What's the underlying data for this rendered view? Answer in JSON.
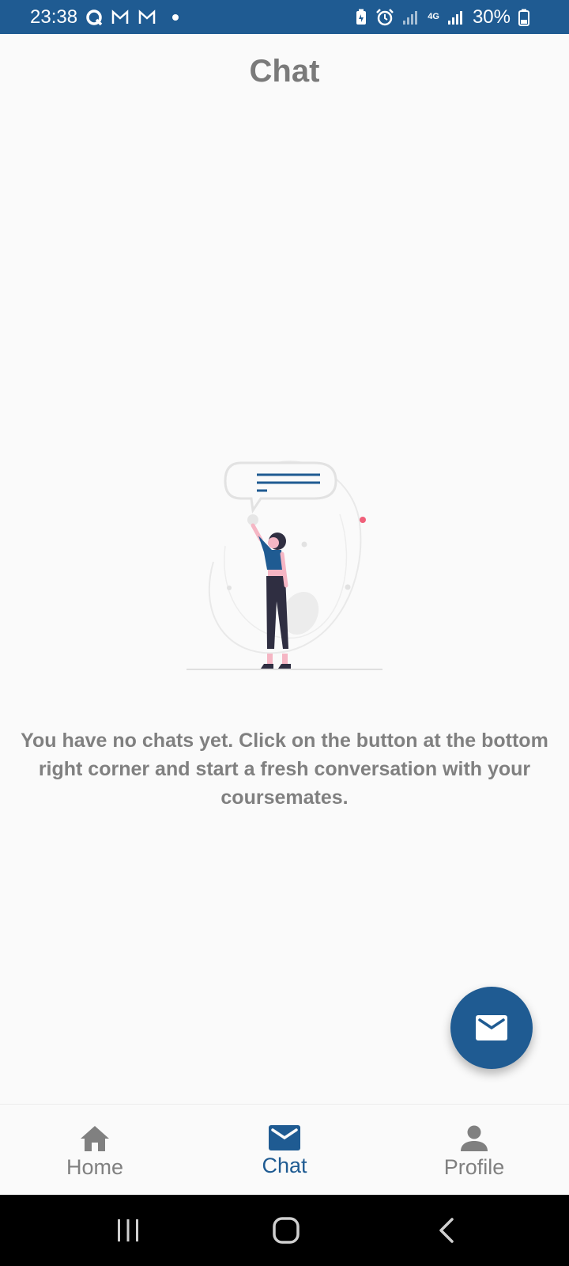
{
  "status_bar": {
    "time": "23:38",
    "battery": "30%",
    "network": "4G",
    "icons": [
      "q-app-icon",
      "gmail-icon",
      "gmail-icon",
      "notification-dot",
      "battery-saver-icon",
      "alarm-icon",
      "signal-icon",
      "signal-icon",
      "battery-icon"
    ]
  },
  "header": {
    "title": "Chat"
  },
  "empty_state": {
    "message": "You have no chats yet. Click on the button at the bottom right corner and start a fresh conversation with your coursemates."
  },
  "fab": {
    "icon": "mail-icon"
  },
  "bottom_nav": {
    "items": [
      {
        "label": "Home",
        "icon": "home-icon",
        "active": false
      },
      {
        "label": "Chat",
        "icon": "mail-icon",
        "active": true
      },
      {
        "label": "Profile",
        "icon": "person-icon",
        "active": false
      }
    ]
  },
  "system_nav": {
    "icons": [
      "recents-icon",
      "home-circle-icon",
      "back-icon"
    ]
  },
  "colors": {
    "primary": "#1f5b92",
    "text_muted": "#808080",
    "background": "#fafafa"
  }
}
